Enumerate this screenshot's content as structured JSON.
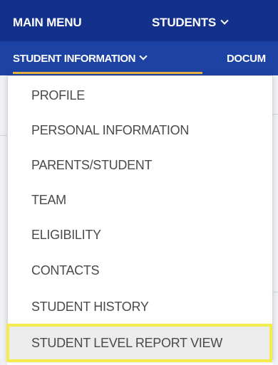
{
  "top_nav": {
    "main_menu_label": "MAIN MENU",
    "students_label": "STUDENTS"
  },
  "sub_nav": {
    "student_information_label": "STUDENT INFORMATION",
    "documents_label": "DOCUM"
  },
  "dropdown": {
    "items": [
      {
        "label": "PROFILE"
      },
      {
        "label": "PERSONAL INFORMATION"
      },
      {
        "label": "PARENTS/STUDENT"
      },
      {
        "label": "TEAM"
      },
      {
        "label": "ELIGIBILITY"
      },
      {
        "label": "CONTACTS"
      },
      {
        "label": "STUDENT HISTORY"
      },
      {
        "label": "STUDENT LEVEL REPORT VIEW",
        "highlighted": true
      }
    ]
  },
  "colors": {
    "top_nav_bg": "#13308a",
    "sub_nav_bg": "#1c42a3",
    "active_underline": "#e2b13c",
    "highlight_border": "#f3ec4a"
  },
  "icons": {
    "students_dropdown": "chevron-down-icon",
    "student_information_dropdown": "chevron-down-icon"
  }
}
